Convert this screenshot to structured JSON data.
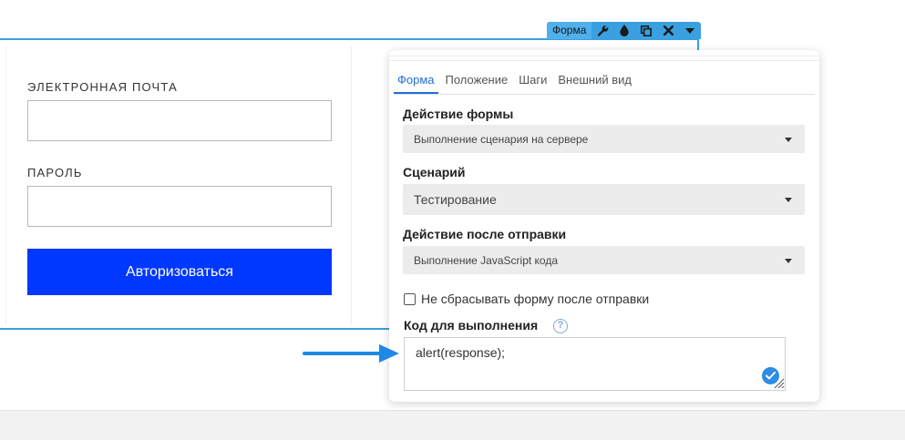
{
  "form": {
    "email_label": "ЭЛЕКТРОННАЯ ПОЧТА",
    "email_value": "",
    "password_label": "ПАРОЛЬ",
    "password_value": "",
    "submit_label": "Авторизоваться"
  },
  "toolbar": {
    "title": "Форма",
    "icons": [
      "wrench-icon",
      "drop-icon",
      "duplicate-icon",
      "close-icon",
      "caret-down-icon"
    ]
  },
  "popup": {
    "tabs": [
      {
        "label": "Форма",
        "active": true
      },
      {
        "label": "Положение",
        "active": false
      },
      {
        "label": "Шаги",
        "active": false
      },
      {
        "label": "Внешний вид",
        "active": false
      }
    ],
    "form_action_label": "Действие формы",
    "form_action_value": "Выполнение сценария на сервере",
    "scenario_label": "Сценарий",
    "scenario_value": "Тестирование",
    "after_submit_label": "Действие после отправки",
    "after_submit_value": "Выполнение JavaScript кода",
    "no_reset_label": "Не сбрасывать форму после отправки",
    "no_reset_checked": false,
    "code_label": "Код для выполнения",
    "code_value": "alert(response);"
  },
  "colors": {
    "accent": "#3aa0e0",
    "submit_button": "#0038ff",
    "active_tab": "#1e6fd9",
    "arrow": "#1e88e5"
  }
}
